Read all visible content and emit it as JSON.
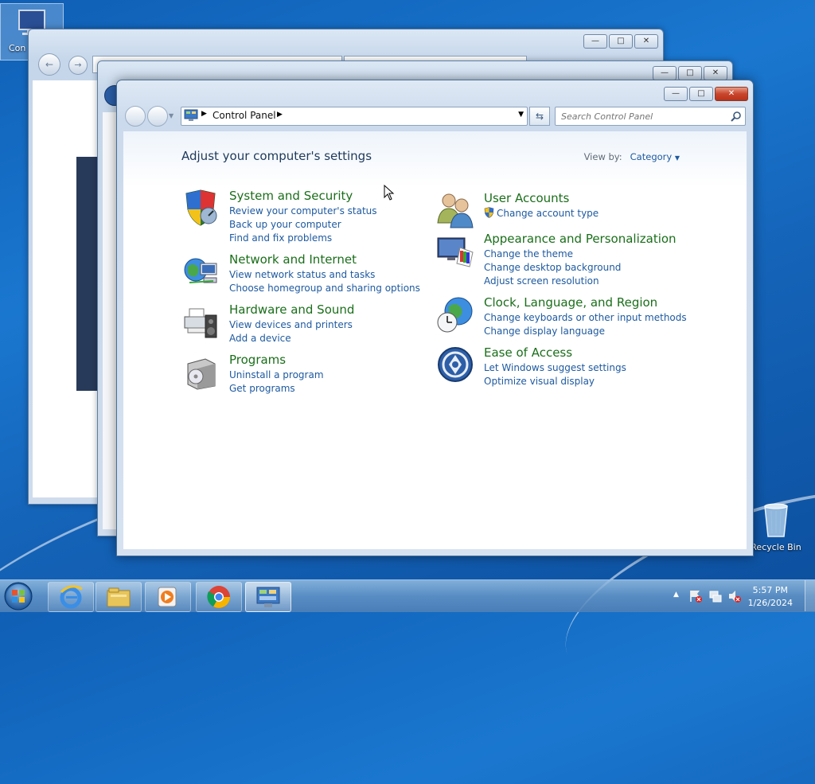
{
  "desktop": {
    "top_icon_label": "Con",
    "recycle_bin_label": "Recycle Bin"
  },
  "window": {
    "breadcrumb": [
      "Control Panel"
    ],
    "search_placeholder": "Search Control Panel",
    "heading": "Adjust your computer's settings",
    "view_by_label": "View by:",
    "view_by_value": "Category",
    "caption_icons": [
      "minimize-icon",
      "maximize-icon",
      "close-icon"
    ]
  },
  "categories": [
    {
      "title": "System and Security",
      "icon": "shield-icon",
      "links": [
        "Review your computer's status",
        "Back up your computer",
        "Find and fix problems"
      ]
    },
    {
      "title": "Network and Internet",
      "icon": "network-globe-icon",
      "links": [
        "View network status and tasks",
        "Choose homegroup and sharing options"
      ]
    },
    {
      "title": "Hardware and Sound",
      "icon": "printer-speaker-icon",
      "links": [
        "View devices and printers",
        "Add a device"
      ]
    },
    {
      "title": "Programs",
      "icon": "programs-box-icon",
      "links": [
        "Uninstall a program",
        "Get programs"
      ]
    },
    {
      "title": "User Accounts",
      "icon": "users-icon",
      "links": [
        "Change account type"
      ]
    },
    {
      "title": "Appearance and Personalization",
      "icon": "monitor-palette-icon",
      "links": [
        "Change the theme",
        "Change desktop background",
        "Adjust screen resolution"
      ]
    },
    {
      "title": "Clock, Language, and Region",
      "icon": "globe-clock-icon",
      "links": [
        "Change keyboards or other input methods",
        "Change display language"
      ]
    },
    {
      "title": "Ease of Access",
      "icon": "accessibility-icon",
      "links": [
        "Let Windows suggest settings",
        "Optimize visual display"
      ]
    }
  ],
  "taskbar": {
    "buttons": [
      "start-orb-icon",
      "internet-explorer-icon",
      "file-explorer-icon",
      "media-player-icon",
      "chrome-icon",
      "control-panel-icon"
    ],
    "tray_icons": [
      "show-hidden-icons-icon",
      "action-center-icon",
      "network-icon",
      "volume-muted-icon"
    ],
    "time": "5:57 PM",
    "date": "1/26/2024"
  }
}
